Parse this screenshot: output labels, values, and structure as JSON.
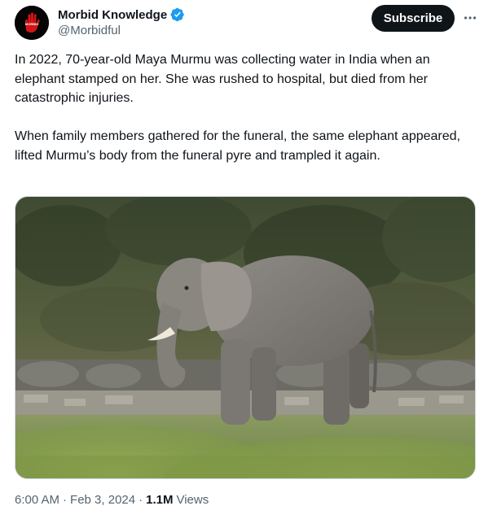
{
  "author": {
    "display_name": "Morbid Knowledge",
    "handle": "@Morbidful",
    "avatar_icon": "red-hand-icon",
    "verified_icon": "verified-badge-icon",
    "verified_color": "#1d9bf0"
  },
  "actions": {
    "subscribe_label": "Subscribe",
    "more_icon": "more-horizontal-icon"
  },
  "tweet": {
    "paragraphs": [
      "In 2022, 70-year-old Maya Murmu was collecting water in India when an elephant stamped on her. She was rushed to hospital, but died from her catastrophic injuries.",
      "When family members gathered for the funeral, the same elephant appeared, lifted Murmu’s body from the funeral pyre and trampled it again."
    ]
  },
  "media": {
    "alt_icon": "elephant-photo"
  },
  "meta": {
    "time": "6:00 AM",
    "separator": "·",
    "date": "Feb 3, 2024",
    "views_count": "1.1M",
    "views_label": "Views"
  },
  "colors": {
    "text_primary": "#0f1419",
    "text_secondary": "#536471",
    "button_bg": "#0f1419",
    "avatar_accent": "#d41414"
  }
}
